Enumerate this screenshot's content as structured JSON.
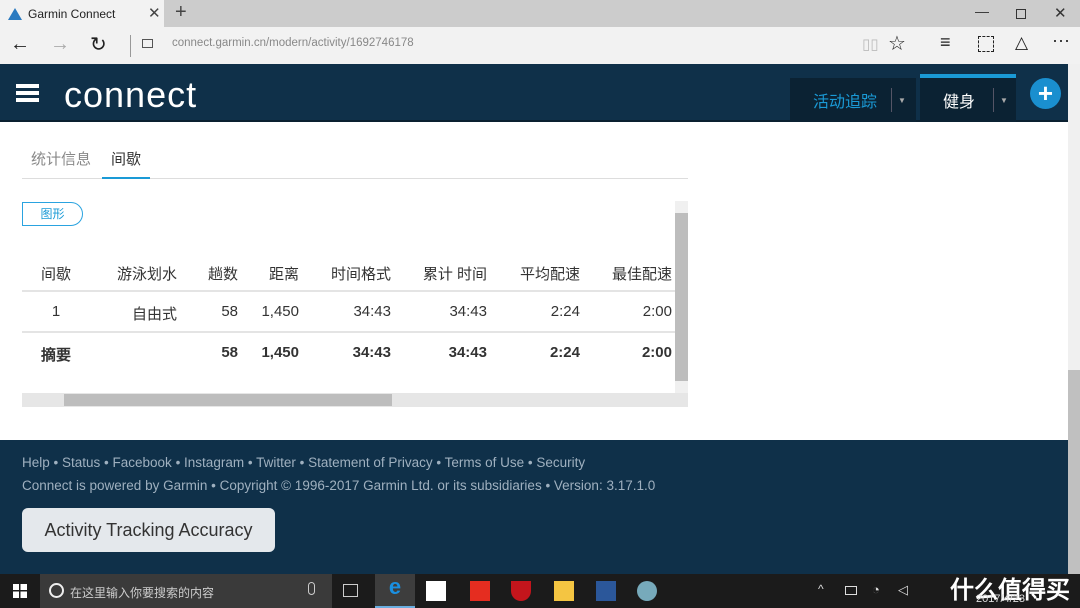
{
  "browser": {
    "tab_title": "Garmin Connect",
    "url_host": "connect.garmin.cn",
    "url_path": "/modern/activity/1692746178"
  },
  "header": {
    "logo": "connect",
    "nav": [
      {
        "label": "活动追踪",
        "color": "#1a9ad6"
      },
      {
        "label": "健身",
        "active": true
      }
    ],
    "add_icon": "plus-icon"
  },
  "tabs": [
    {
      "label": "统计信息"
    },
    {
      "label": "间歇",
      "active": true
    }
  ],
  "chart_button": "图形",
  "table": {
    "headers": [
      "间歇",
      "游泳划水",
      "趟数",
      "距离",
      "时间格式",
      "累计 时间",
      "平均配速",
      "最佳配速"
    ],
    "rows": [
      [
        "1",
        "自由式",
        "58",
        "1,450",
        "34:43",
        "34:43",
        "2:24",
        "2:00"
      ]
    ],
    "summary": [
      "摘要",
      "",
      "58",
      "1,450",
      "34:43",
      "34:43",
      "2:24",
      "2:00"
    ]
  },
  "footer": {
    "links": [
      "Help",
      "Status",
      "Facebook",
      "Instagram",
      "Twitter",
      "Statement of Privacy",
      "Terms of Use",
      "Security"
    ],
    "powered": "Connect is powered by Garmin",
    "copyright": "• Copyright © 1996-2017 Garmin Ltd. or its subsidiaries • Version: 3.17.1.0",
    "accuracy_button": "Activity Tracking Accuracy"
  },
  "taskbar": {
    "search_placeholder": "在这里输入你要搜索的内容",
    "date": "2017/4/23",
    "watermark": "什么值得买"
  },
  "colors": {
    "header": "#0f3049",
    "accent": "#1a9ad6"
  }
}
